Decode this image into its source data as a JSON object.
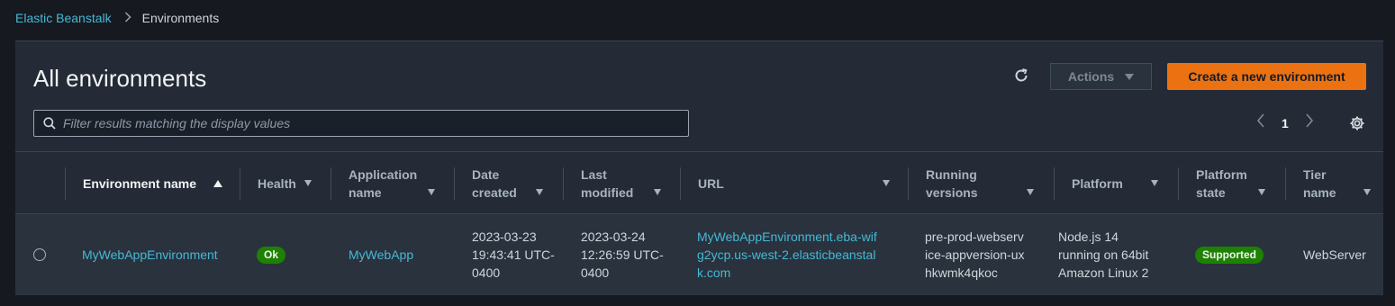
{
  "breadcrumb": {
    "parent": "Elastic Beanstalk",
    "current": "Environments"
  },
  "page": {
    "title": "All environments"
  },
  "toolbar": {
    "actions_label": "Actions",
    "create_label": "Create a new environment"
  },
  "filter": {
    "placeholder": "Filter results matching the display values",
    "value": ""
  },
  "pagination": {
    "current_page": "1"
  },
  "columns": {
    "env_name": "Environment name",
    "health": "Health",
    "app_name": "Application name",
    "date_created": "Date created",
    "last_modified": "Last modified",
    "url": "URL",
    "running_versions": "Running versions",
    "platform": "Platform",
    "platform_state": "Platform state",
    "tier_name": "Tier name"
  },
  "rows": [
    {
      "env_name": "MyWebAppEnvironment",
      "health": "Ok",
      "app_name": "MyWebApp",
      "date_created": "2023-03-23 19:43:41 UTC-0400",
      "last_modified": "2023-03-24 12:26:59 UTC-0400",
      "url": "MyWebAppEnvironment.eba-wifg2ycp.us-west-2.elasticbeanstalk.com",
      "running_versions": "pre-prod-webservice-appversion-uxhkwmk4qkoc",
      "platform": "Node.js 14 running on 64bit Amazon Linux 2",
      "platform_state": "Supported",
      "tier_name": "WebServer"
    }
  ],
  "colors": {
    "background": "#16191f",
    "panel": "#242b36",
    "link": "#44b9d6",
    "primary_button": "#ec7211",
    "status_green": "#1d8102"
  },
  "icons": [
    "chevron-right-icon",
    "refresh-icon",
    "caret-down-icon",
    "search-icon",
    "chevron-left-icon",
    "gear-icon",
    "sort-ascending-icon",
    "sort-down-icon",
    "radio-icon"
  ]
}
